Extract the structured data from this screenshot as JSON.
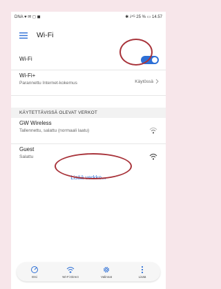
{
  "statusbar": {
    "left": "DNA ♥ ✉ ◻ ◼",
    "right": "✱ ⅈ⁴ᴳ 25 % ▭ 14.57"
  },
  "appbar": {
    "title": "Wi-Fi"
  },
  "wifi_toggle": {
    "label": "Wi-Fi",
    "on": true
  },
  "wifi_plus": {
    "label": "Wi-Fi+",
    "sub": "Parannettu Internet-kokemus",
    "value": "Käytössä"
  },
  "section": {
    "title": "KÄYTETTÄVISSÄ OLEVAT VERKOT"
  },
  "networks": [
    {
      "name": "GW Wireless",
      "sub": "Tallennettu, salattu (normaali laatu)"
    },
    {
      "name": "Guest",
      "sub": "Salattu"
    }
  ],
  "add_network": {
    "label": "Lisää verkko..."
  },
  "bottom_bar": [
    {
      "label": "Etsi",
      "icon": "scan-icon"
    },
    {
      "label": "Wi-Fi Direct",
      "icon": "wifi-direct-icon"
    },
    {
      "label": "Valinnat",
      "icon": "settings-icon"
    },
    {
      "label": "Lisää",
      "icon": "more-icon"
    }
  ],
  "colors": {
    "accent": "#2d6fd6",
    "highlight": "#a8333a",
    "background": "#f7e6ea"
  }
}
